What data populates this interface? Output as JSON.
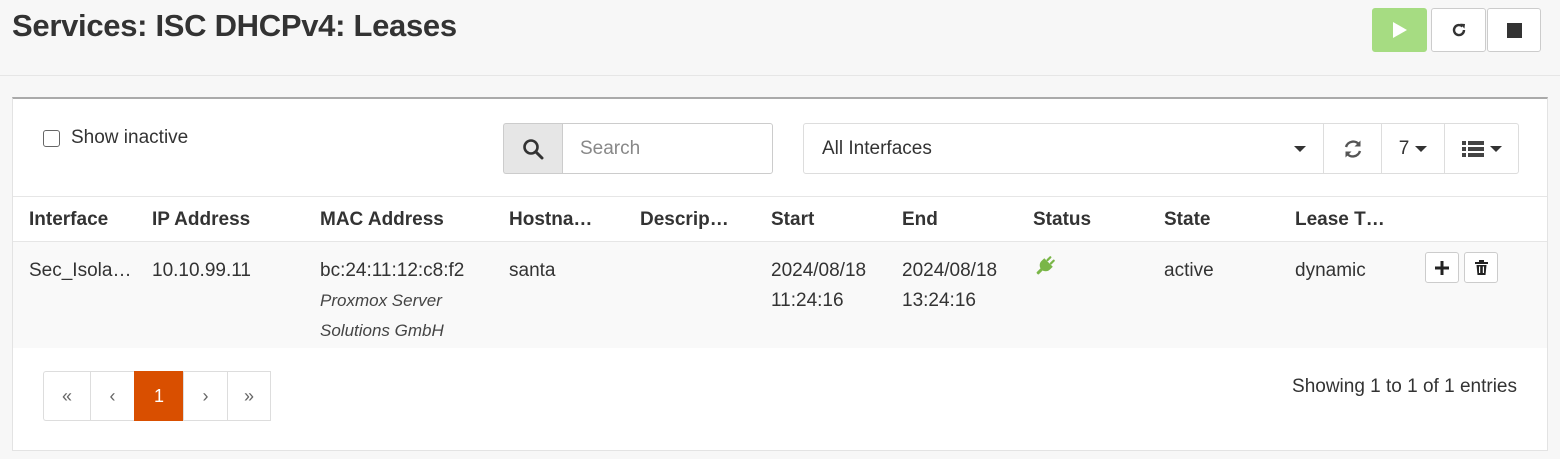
{
  "page": {
    "title": "Services: ISC DHCPv4: Leases"
  },
  "service_buttons": {
    "start_color": "#a6dc82"
  },
  "filters": {
    "show_inactive_label": "Show inactive",
    "show_inactive_checked": false,
    "search_placeholder": "Search",
    "search_value": "",
    "interface_selected": "All Interfaces",
    "row_count": "7"
  },
  "table": {
    "columns": [
      "Interface",
      "IP Address",
      "MAC Address",
      "Hostna…",
      "Descrip…",
      "Start",
      "End",
      "Status",
      "State",
      "Lease T…"
    ],
    "rows": [
      {
        "interface": "Sec_Isola…",
        "ip": "10.10.99.11",
        "mac": "bc:24:11:12:c8:f2",
        "mac_vendor_line1": "Proxmox Server",
        "mac_vendor_line2": "Solutions GmbH",
        "hostname": "santa",
        "description": "",
        "start_date": "2024/08/18",
        "start_time": "11:24:16",
        "end_date": "2024/08/18",
        "end_time": "13:24:16",
        "status_icon": "plug-icon",
        "status_color": "#7ab648",
        "state": "active",
        "lease_type": "dynamic"
      }
    ]
  },
  "pagination": {
    "first": "«",
    "prev": "‹",
    "current": "1",
    "next": "›",
    "last": "»",
    "active_color": "#d94f00",
    "info": "Showing 1 to 1 of 1 entries"
  }
}
